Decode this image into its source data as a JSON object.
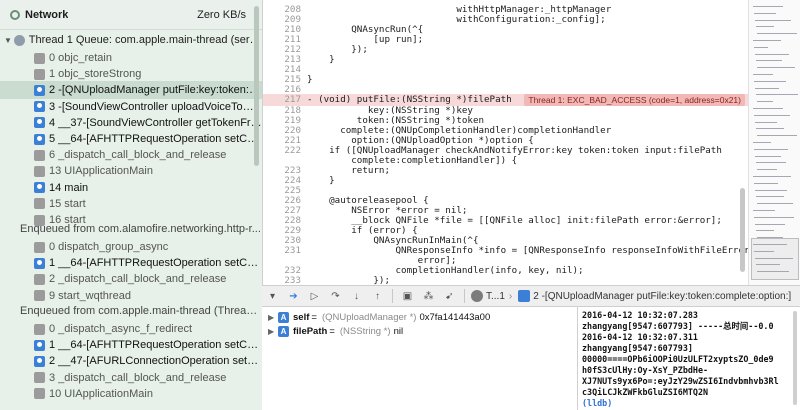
{
  "navigator": {
    "network_label": "Network",
    "network_rate": "Zero KB/s",
    "thread_title": "Thread 1 Queue: com.apple.main-thread (serial)",
    "frames": [
      {
        "text": "0 objc_retain",
        "kind": "sys"
      },
      {
        "text": "1 objc_storeStrong",
        "kind": "sys"
      },
      {
        "text": "2 -[QNUploadManager putFile:key:token:com...",
        "kind": "user"
      },
      {
        "text": "3 -[SoundViewController uploadVoiceToQNFil...",
        "kind": "user"
      },
      {
        "text": "4 __37-[SoundViewController getTokenFromQ...",
        "kind": "user"
      },
      {
        "text": "5 __64-[AFHTTPRequestOperation setComple...",
        "kind": "user"
      },
      {
        "text": "6 _dispatch_call_block_and_release",
        "kind": "sys"
      },
      {
        "text": "13 UIApplicationMain",
        "kind": "sys"
      },
      {
        "text": "14 main",
        "kind": "user"
      },
      {
        "text": "15 start",
        "kind": "sys"
      },
      {
        "text": "16 start",
        "kind": "sys"
      }
    ],
    "enqueued_1": "Enqueued from com.alamofire.networking.http-r...",
    "frames_2": [
      {
        "text": "0 dispatch_group_async",
        "kind": "sys"
      },
      {
        "text": "1 __64-[AFHTTPRequestOperation setComple...",
        "kind": "user"
      },
      {
        "text": "2 _dispatch_call_block_and_release",
        "kind": "sys"
      },
      {
        "text": "9 start_wqthread",
        "kind": "sys"
      }
    ],
    "enqueued_2": "Enqueued from com.apple.main-thread (Thread 1)",
    "frames_3": [
      {
        "text": "0 _dispatch_async_f_redirect",
        "kind": "sys"
      },
      {
        "text": "1 __64-[AFHTTPRequestOperation setComple...",
        "kind": "user"
      },
      {
        "text": "2 __47-[AFURLConnectionOperation setComple...",
        "kind": "user"
      },
      {
        "text": "3 _dispatch_call_block_and_release",
        "kind": "sys"
      },
      {
        "text": "10 UIApplicationMain",
        "kind": "sys"
      }
    ]
  },
  "editor": {
    "lines": [
      {
        "num": "208",
        "code": "                           withHttpManager:_httpManager"
      },
      {
        "num": "209",
        "code": "                           withConfiguration:_config];"
      },
      {
        "num": "210",
        "code": "        QNAsyncRun(^{"
      },
      {
        "num": "211",
        "code": "            [up run];"
      },
      {
        "num": "212",
        "code": "        });"
      },
      {
        "num": "213",
        "code": "    }"
      },
      {
        "num": "214",
        "code": ""
      },
      {
        "num": "215",
        "code": "}"
      },
      {
        "num": "216",
        "code": ""
      },
      {
        "num": "217",
        "code": "- (void) putFile:(NSString *)filePath",
        "hl": true
      },
      {
        "num": "218",
        "code": "           key:(NSString *)key"
      },
      {
        "num": "219",
        "code": "         token:(NSString *)token"
      },
      {
        "num": "220",
        "code": "      complete:(QNUpCompletionHandler)completionHandler"
      },
      {
        "num": "221",
        "code": "        option:(QNUploadOption *)option {"
      },
      {
        "num": "222",
        "code": "    if ([QNUploadManager checkAndNotifyError:key token:token input:filePath"
      },
      {
        "num": "",
        "code": "        complete:completionHandler]) {"
      },
      {
        "num": "223",
        "code": "        return;"
      },
      {
        "num": "224",
        "code": "    }"
      },
      {
        "num": "225",
        "code": ""
      },
      {
        "num": "226",
        "code": "    @autoreleasepool {"
      },
      {
        "num": "227",
        "code": "        NSError *error = nil;"
      },
      {
        "num": "228",
        "code": "        __block QNFile *file = [[QNFile alloc] init:filePath error:&error];"
      },
      {
        "num": "229",
        "code": "        if (error) {"
      },
      {
        "num": "230",
        "code": "            QNAsyncRunInMain(^{"
      },
      {
        "num": "231",
        "code": "                QNResponseInfo *info = [QNResponseInfo responseInfoWithFileError:"
      },
      {
        "num": "",
        "code": "                    error];"
      },
      {
        "num": "232",
        "code": "                completionHandler(info, key, nil);"
      },
      {
        "num": "233",
        "code": "            });"
      }
    ],
    "exception": "Thread 1: EXC_BAD_ACCESS (code=1, address=0x21)"
  },
  "debug_bar": {
    "thread_crumb": "T...1",
    "frame_crumb": "2 -[QNUploadManager putFile:key:token:complete:option:]"
  },
  "variables": [
    {
      "name": "self",
      "type": "(QNUploadManager *)",
      "value": "0x7fa141443a00"
    },
    {
      "name": "filePath",
      "type": "(NSString *)",
      "value": "nil"
    }
  ],
  "console": {
    "lines": [
      "2016-04-12 10:32:07.283",
      "zhangyang[9547:607793] -----总时间--0.0",
      "2016-04-12 10:32:07.311",
      "zhangyang[9547:607793]",
      "00000====OPb6iOOPi0UzULFT2xyptsZO_0de9",
      "h0fS3cUlHy:Oy-XsY_PZbdHe-",
      "XJ7NUTs9yx6Po=:eyJzY29wZSI6Indvbmhvb3Rl",
      "c3QiLCJkZWFkbGluZSI6MTQ2N"
    ],
    "prompt": "(lldb)"
  },
  "colors": {
    "navigator_bg": "#e7f0e9",
    "highlight_line": "#f6d9d8",
    "exception_badge": "#f1b9b6",
    "accent_blue": "#3b7fd6"
  }
}
